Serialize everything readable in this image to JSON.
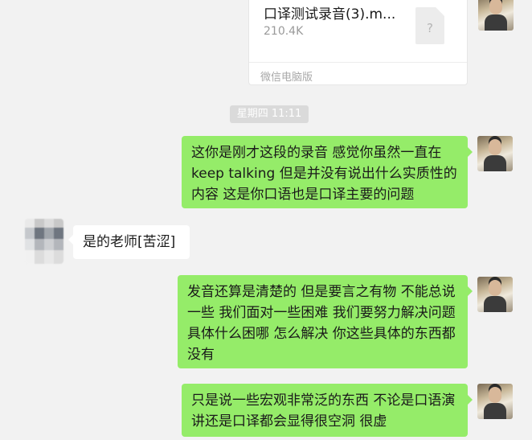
{
  "file_message": {
    "name": "口译测试录音(3).m...",
    "size": "210.4K",
    "source": "微信电脑版",
    "icon": "?"
  },
  "timestamp": "星期四 11:11",
  "messages": [
    {
      "sender": "me",
      "text": "这你是刚才这段的录音 感觉你虽然一直在keep talking 但是并没有说出什么实质性的内容 这是你口语也是口译主要的问题"
    },
    {
      "sender": "them",
      "text": "是的老师[苦涩]"
    },
    {
      "sender": "me",
      "text": "发音还算是清楚的 但是要言之有物 不能总说一些 我们面对一些困难 我们要努力解决问题 具体什么困哪 怎么解决 你这些具体的东西都没有"
    },
    {
      "sender": "me",
      "text": "只是说一些宏观非常泛的东西 不论是口语演讲还是口译都会显得很空洞 很虚"
    }
  ],
  "colors": {
    "sent_bubble": "#95ec69",
    "received_bubble": "#ffffff",
    "background": "#f2f2f2"
  }
}
